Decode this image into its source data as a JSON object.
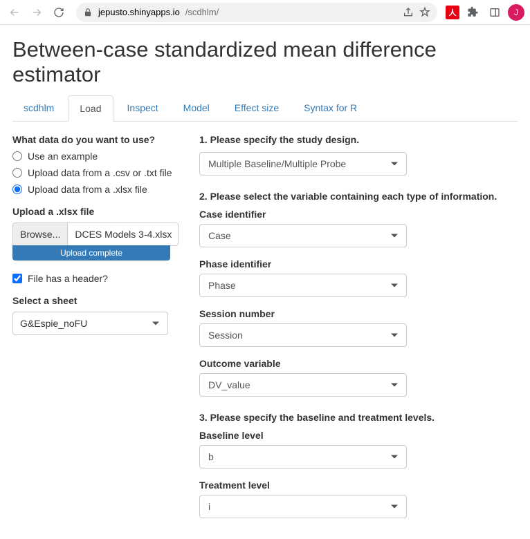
{
  "browser": {
    "domain": "jepusto.shinyapps.io",
    "path": "/scdhlm/",
    "avatarInitial": "J",
    "extBadge": "人"
  },
  "page": {
    "title": "Between-case standardized mean difference estimator",
    "tabs": [
      "scdhlm",
      "Load",
      "Inspect",
      "Model",
      "Effect size",
      "Syntax for R"
    ],
    "activeTab": 1
  },
  "left": {
    "question": "What data do you want to use?",
    "radios": {
      "example": "Use an example",
      "csv": "Upload data from a .csv or .txt file",
      "xlsx": "Upload data from a .xlsx file"
    },
    "uploadLabel": "Upload a .xlsx file",
    "browse": "Browse...",
    "fileName": "DCES Models 3-4.xlsx",
    "progress": "Upload complete",
    "headerCheckbox": "File has a header?",
    "sheetLabel": "Select a sheet",
    "sheetValue": "G&Espie_noFU"
  },
  "right": {
    "step1": "1. Please specify the study design.",
    "designValue": "Multiple Baseline/Multiple Probe",
    "step2": "2. Please select the variable containing each type of information.",
    "caseLabel": "Case identifier",
    "caseValue": "Case",
    "phaseLabel": "Phase identifier",
    "phaseValue": "Phase",
    "sessionLabel": "Session number",
    "sessionValue": "Session",
    "outcomeLabel": "Outcome variable",
    "outcomeValue": "DV_value",
    "step3": "3. Please specify the baseline and treatment levels.",
    "baselineLabel": "Baseline level",
    "baselineValue": "b",
    "treatmentLabel": "Treatment level",
    "treatmentValue": "i"
  }
}
